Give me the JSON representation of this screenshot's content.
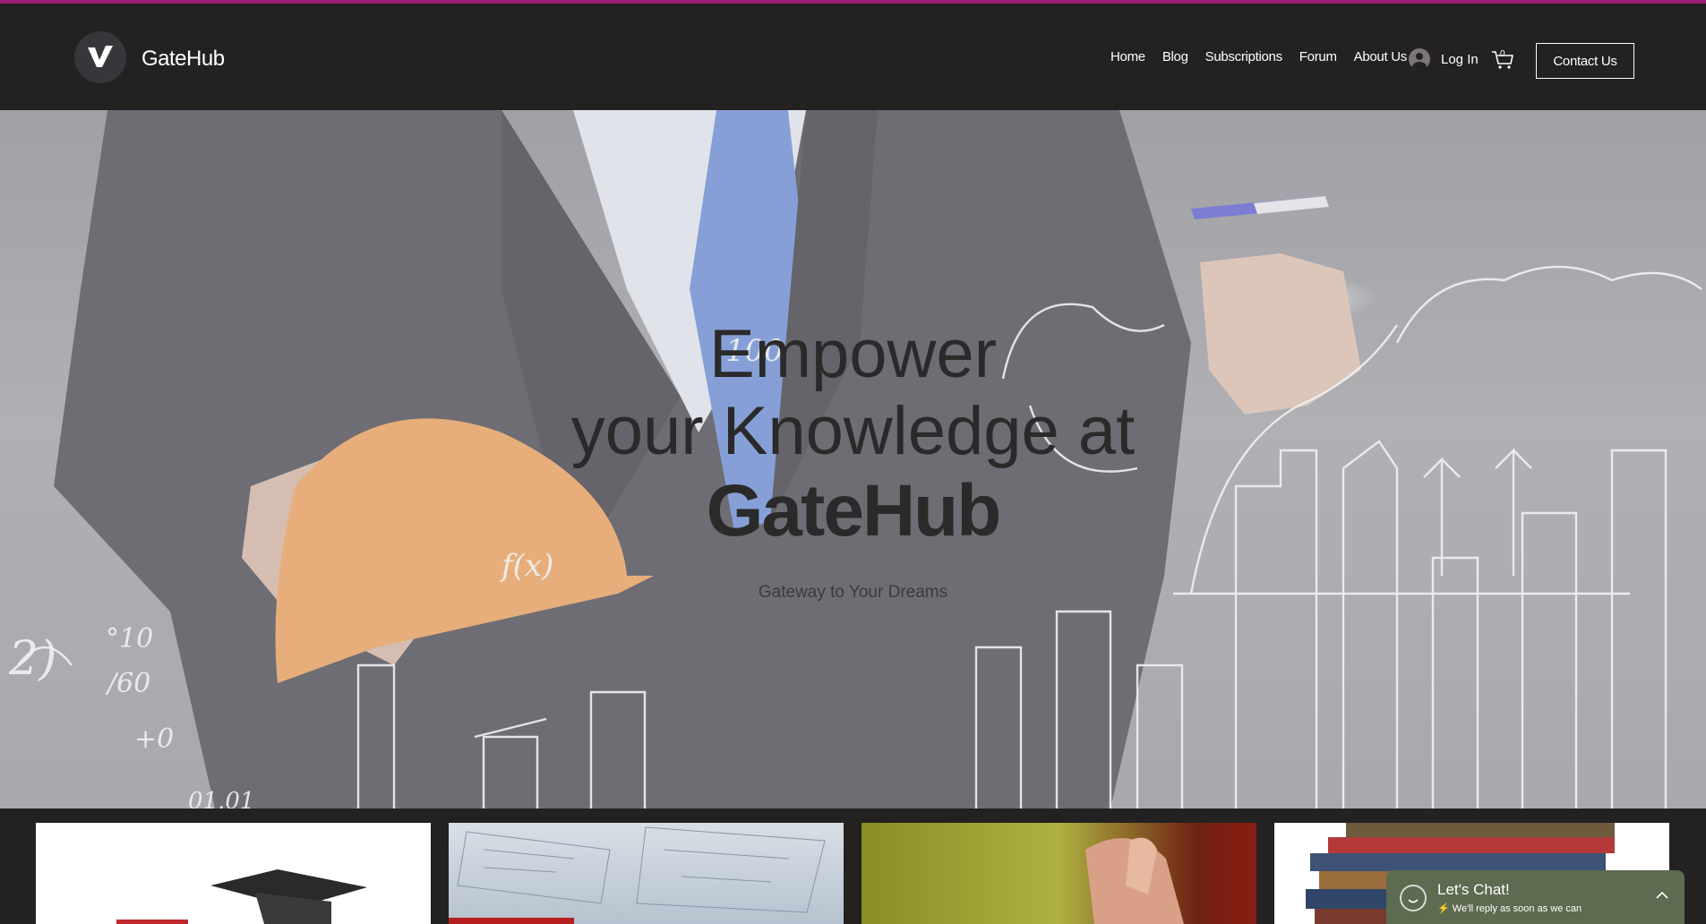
{
  "brand": {
    "name": "GateHub",
    "logo_icon": "checkmark-logo-icon"
  },
  "nav": {
    "items": [
      {
        "label": "Home"
      },
      {
        "label": "Blog"
      },
      {
        "label": "Subscriptions"
      },
      {
        "label": "Forum"
      },
      {
        "label": "About Us"
      }
    ],
    "login_label": "Log In",
    "cart_count": "0",
    "contact_label": "Contact Us"
  },
  "hero": {
    "line1": "Empower",
    "line2": "your Knowledge at",
    "line3": "GateHub",
    "subtitle": "Gateway to Your Dreams"
  },
  "chat": {
    "title": "Let's Chat!",
    "subtitle": "We'll reply as soon as we can"
  },
  "colors": {
    "accent_top_line": "#9b1b74",
    "header_bg": "#242121",
    "chat_bg": "#5d6b50"
  }
}
